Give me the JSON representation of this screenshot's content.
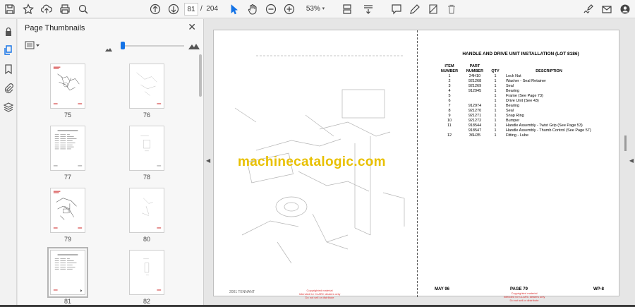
{
  "toolbar": {
    "current_page": "81",
    "page_separator": "/",
    "total_pages": "204",
    "zoom": "53%"
  },
  "thumbnails_panel": {
    "title": "Page Thumbnails",
    "close_label": "✕",
    "pages": [
      "75",
      "76",
      "77",
      "78",
      "79",
      "80",
      "81",
      "82"
    ],
    "selected_page": "81"
  },
  "document": {
    "header_title": "HANDLE AND DRIVE UNIT INSTALLATION (LOT 8186)",
    "columns": [
      "ITEM NUMBER",
      "PART NUMBER",
      "QTY",
      "DESCRIPTION"
    ],
    "rows": [
      [
        "1",
        "24H10",
        "1",
        "Lock Nut"
      ],
      [
        "2",
        "921268",
        "1",
        "Washer - Seal Retainer"
      ],
      [
        "3",
        "921269",
        "1",
        "Seal"
      ],
      [
        "4",
        "912945",
        "1",
        "Bearing"
      ],
      [
        "5",
        "",
        "1",
        "Frame (See Page 73)"
      ],
      [
        "6",
        "",
        "1",
        "Drive Unit (See 43)"
      ],
      [
        "7",
        "912974",
        "1",
        "Bearing"
      ],
      [
        "8",
        "921270",
        "1",
        "Seal"
      ],
      [
        "9",
        "921271",
        "1",
        "Snap Ring"
      ],
      [
        "10",
        "921272",
        "1",
        "Bumper"
      ],
      [
        "11",
        "918544",
        "1",
        "Handle Assembly - Twist Grip (See Page 53)"
      ],
      [
        "",
        "918547",
        "1",
        "Handle Assembly - Thumb Control (See Page 57)"
      ],
      [
        "12",
        "36H35",
        "1",
        "Fitting - Lube"
      ]
    ],
    "watermark": "machinecatalogic.com",
    "footer_date": "MAY 96",
    "footer_page": "PAGE 79",
    "footer_code": "WP-8",
    "footer_left_text": "2001 TENNANT",
    "copyright_lines": [
      "Copyrighted material",
      "Intended for CLARC dealers only",
      "Do not sell or distribute"
    ]
  },
  "colors": {
    "accent": "#1473e6",
    "watermark": "#e8c000",
    "copyright": "#dd3333"
  }
}
